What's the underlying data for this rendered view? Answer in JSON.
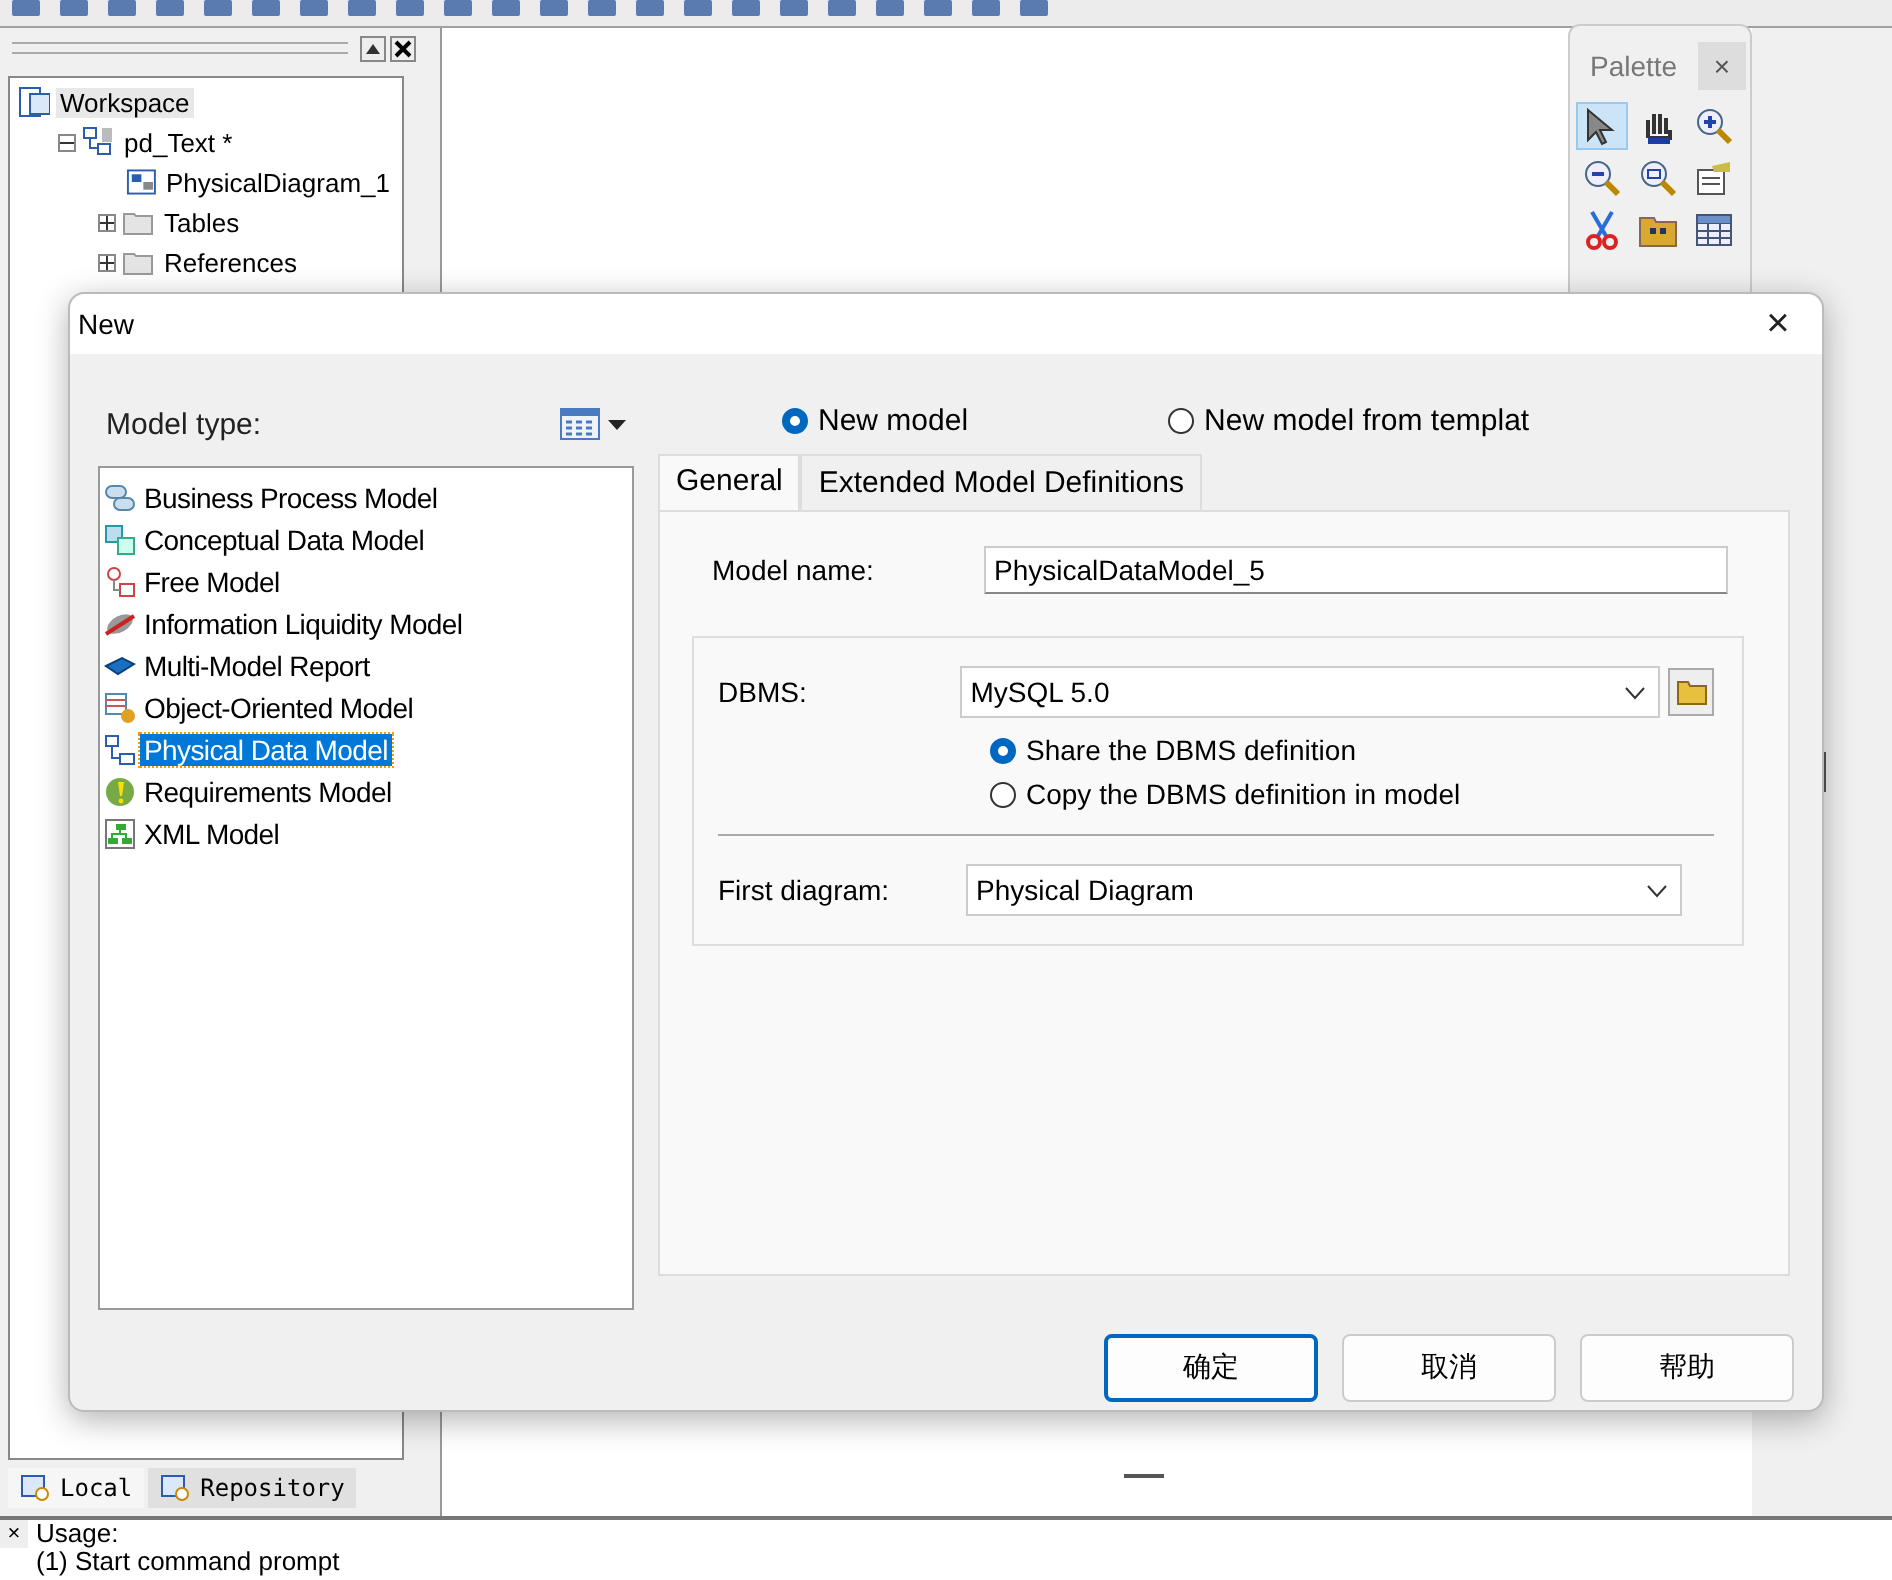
{
  "workspace_tree": [
    {
      "label": "Workspace",
      "selected": true,
      "children": [
        {
          "label": "pd_Text *",
          "selected": false,
          "expanded": true,
          "children": [
            {
              "label": "PhysicalDiagram_1",
              "selected": false
            },
            {
              "label": "Tables",
              "selected": false,
              "expanded": false
            },
            {
              "label": "References",
              "selected": false,
              "expanded": false
            }
          ]
        }
      ]
    }
  ],
  "browser_tabs": [
    {
      "label": "Local",
      "selected": true
    },
    {
      "label": "Repository",
      "selected": false
    }
  ],
  "palette": {
    "title": "Palette",
    "close": "×",
    "tools": [
      {
        "selected": true
      },
      {
        "selected": false
      },
      {
        "selected": false
      },
      {
        "selected": false
      },
      {
        "selected": false
      },
      {
        "selected": false
      },
      {
        "selected": false
      },
      {
        "selected": false
      },
      {
        "selected": false
      }
    ]
  },
  "output": {
    "close": "×",
    "lines": [
      "Usage:",
      "(1) Start command prompt"
    ]
  },
  "dialog": {
    "title": "New",
    "close": "×",
    "model_type_label": "Model type:",
    "model_types": [
      {
        "label": "Business Process Model",
        "selected": false
      },
      {
        "label": "Conceptual Data Model",
        "selected": false
      },
      {
        "label": "Free Model",
        "selected": false
      },
      {
        "label": "Information Liquidity Model",
        "selected": false
      },
      {
        "label": "Multi-Model Report",
        "selected": false
      },
      {
        "label": "Object-Oriented Model",
        "selected": false
      },
      {
        "label": "Physical Data Model",
        "selected": true
      },
      {
        "label": "Requirements Model",
        "selected": false
      },
      {
        "label": "XML Model",
        "selected": false
      }
    ],
    "creation_modes": [
      {
        "label": "New model",
        "selected": true
      },
      {
        "label": "New model from templat",
        "selected": false
      }
    ],
    "tabs": [
      {
        "label": "General",
        "selected": true
      },
      {
        "label": "Extended Model Definitions",
        "selected": false
      }
    ],
    "model_name": {
      "label": "Model name:",
      "value": "PhysicalDataModel_5"
    },
    "dbms": {
      "label": "DBMS:",
      "value": "MySQL 5.0"
    },
    "dbms_options": [
      {
        "label": "Share the DBMS definition",
        "selected": true
      },
      {
        "label": "Copy the DBMS definition in model",
        "selected": false
      }
    ],
    "first_diagram": {
      "label": "First diagram:",
      "value": "Physical Diagram"
    },
    "buttons": [
      {
        "label": "确定",
        "default": true
      },
      {
        "label": "取消",
        "default": false
      },
      {
        "label": "帮助",
        "default": false
      }
    ]
  }
}
